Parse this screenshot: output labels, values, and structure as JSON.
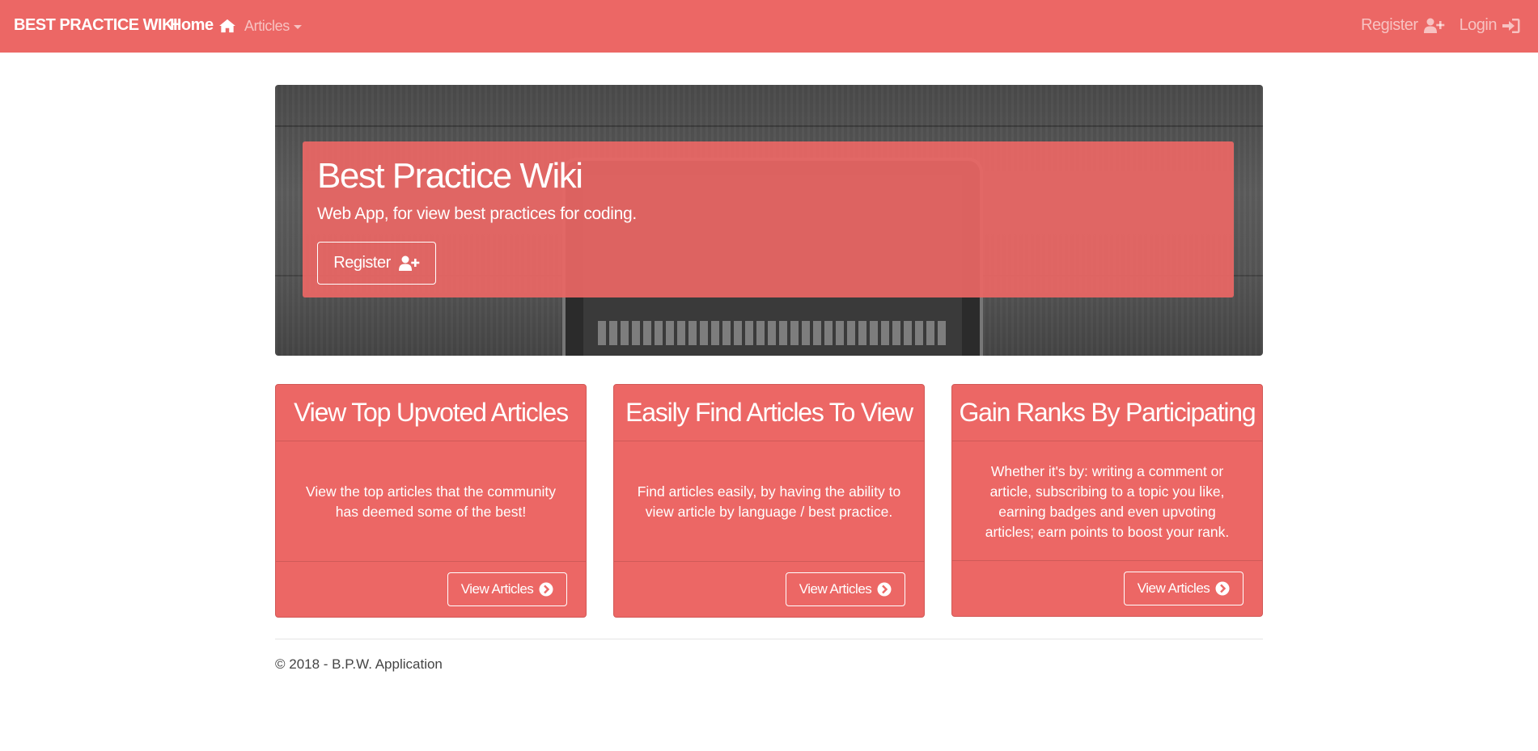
{
  "navbar": {
    "brand": "BEST PRACTICE WIKI",
    "home_label": "Home",
    "articles_label": "Articles",
    "register_label": "Register",
    "login_label": "Login"
  },
  "hero": {
    "title": "Best Practice Wiki",
    "subtitle": "Web App, for view best practices for coding.",
    "register_button": "Register"
  },
  "cards": [
    {
      "title": "View Top Upvoted Articles",
      "text": "View the top articles that the community has deemed some of the best!",
      "button": "View Articles"
    },
    {
      "title": "Easily Find Articles To View",
      "text": "Find articles easily, by having the ability to view article by language / best practice.",
      "button": "View Articles"
    },
    {
      "title": "Gain Ranks By Participating",
      "text": "Whether it's by: writing a comment or article, subscribing to a topic you like, earning badges and even upvoting articles; earn points to boost your rank.",
      "button": "View Articles"
    }
  ],
  "footer": {
    "copyright": "© 2018 - B.P.W. Application"
  },
  "colors": {
    "primary": "#ec6765",
    "text": "#ffffff"
  },
  "icons": {
    "home": "home-icon",
    "register": "user-plus-icon",
    "login": "sign-in-icon",
    "view": "chevron-circle-right-icon"
  }
}
